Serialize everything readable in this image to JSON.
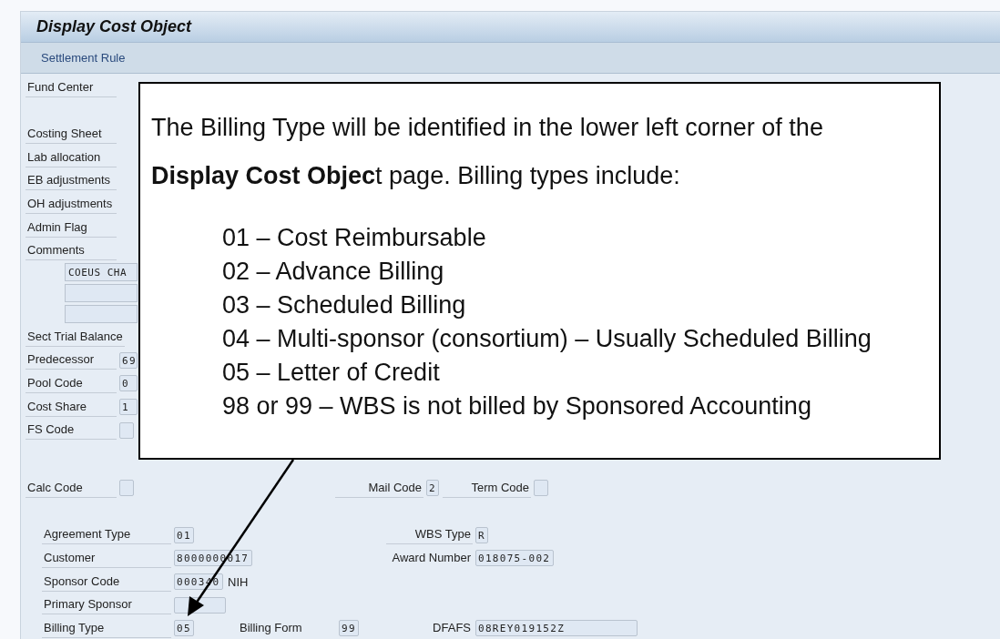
{
  "header": {
    "title": "Display Cost Object"
  },
  "toolbar": {
    "items": [
      "Settlement Rule"
    ]
  },
  "left_fields": [
    {
      "label": "Fund Center",
      "kind": "label"
    },
    {
      "label": "Costing Sheet",
      "kind": "label"
    },
    {
      "label": "Lab allocation",
      "kind": "label"
    },
    {
      "label": "EB adjustments",
      "kind": "label"
    },
    {
      "label": "OH adjustments",
      "kind": "label"
    },
    {
      "label": "Admin Flag",
      "kind": "label"
    },
    {
      "label": "Comments",
      "kind": "comments",
      "lines": [
        {
          "kind": "text",
          "value": "COEUS CHA"
        },
        {
          "kind": "empty"
        },
        {
          "kind": "empty"
        }
      ]
    },
    {
      "label": "Sect Trial Balance",
      "kind": "label"
    },
    {
      "label": "Predecessor",
      "kind": "field",
      "value": "69"
    },
    {
      "label": "Pool Code",
      "kind": "field",
      "value": "0"
    },
    {
      "label": "Cost Share",
      "kind": "field",
      "value": "1"
    },
    {
      "label": "FS Code",
      "kind": "field"
    }
  ],
  "codes": [
    {
      "label": "Calc Code"
    },
    {
      "label": "Mail Code",
      "value": "2"
    },
    {
      "label": "Term Code"
    }
  ],
  "agreement_rows": [
    {
      "label": "Agreement Type",
      "value": "01",
      "right": {
        "label": "WBS Type",
        "value": "R"
      }
    },
    {
      "label": "Customer",
      "value": "8000000017",
      "right": {
        "label": "Award Number",
        "value": "018075-002"
      }
    },
    {
      "label": "Sponsor Code",
      "value": "000340",
      "note": "NIH"
    },
    {
      "label": "Primary Sponsor"
    },
    {
      "label": "Billing Type",
      "value": "05",
      "middle": {
        "label": "Billing Form",
        "value": "99"
      },
      "right": {
        "label": "DFAFS",
        "value": "08REY019152Z"
      }
    }
  ],
  "callout": {
    "intro": [
      "The Billing Type will be identified in the lower left corner of the",
      "**Display Cost Objec**t page.  Billing types include:"
    ],
    "items": [
      "01 – Cost Reimbursable",
      "02 – Advance Billing",
      "03 – Scheduled Billing",
      "04 – Multi-sponsor (consortium) – Usually Scheduled Billing",
      "05 – Letter of Credit",
      "98 or 99 – WBS is not billed by Sponsored Accounting"
    ]
  }
}
